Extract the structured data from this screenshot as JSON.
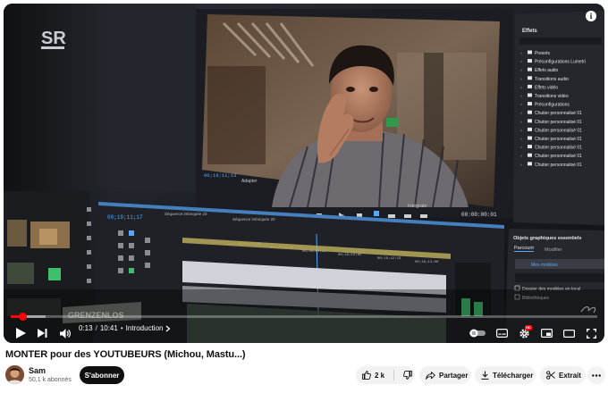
{
  "video": {
    "overlay": {
      "channel_logo": "SR",
      "watermark": "GRENZENLOS"
    },
    "effects_panel": {
      "title": "Effets",
      "items": [
        "Presets",
        "Préconfigurations Lumetri",
        "Effets audio",
        "Transitions audio",
        "Effets vidéo",
        "Transitions vidéo",
        "Préconfigurations",
        "Chutier personnalisé 01",
        "Chutier personnalisé 01",
        "Chutier personnalisé 01",
        "Chutier personnalisé 01",
        "Chutier personnalisé 01",
        "Chutier personnalisé 01",
        "Chutier personnalisé 01"
      ]
    },
    "graphics_panel": {
      "title": "Objets graphiques essentiels",
      "tab_browse": "Parcourir",
      "tab_edit": "Modifier",
      "my_templates": "Mes modèles",
      "local_folder": "Dossier des modèles en local",
      "libraries": "Bibliothèques"
    },
    "monitor": {
      "timecode_left": "00;19;11;13",
      "fit": "Adapter",
      "quality": "Intégrale",
      "timecode_right": "00:00:00:01"
    },
    "timeline": {
      "timecode": "00;19;11;17",
      "sequence_labels": [
        "Séquence imbriquée 23",
        "Séquence imbriquée 20"
      ],
      "ruler_marks": [
        "00;19;11;05",
        "00;19;11;09",
        "00;19;11;13",
        "00;19;12;05",
        "00;19;12;13",
        "00;19;13;00"
      ]
    }
  },
  "player": {
    "current_time": "0:13",
    "duration": "10:41",
    "chapter": "Introduction",
    "progress_fraction": 0.0203,
    "buffered_fraction": 0.06,
    "info_icon": "info-icon",
    "hd_badge": "HD"
  },
  "details": {
    "title": "MONTER pour des YOUTUBEURS (Michou, Mastu...)",
    "channel": "Sam",
    "subscribers": "50,1 k abonnés",
    "subscribe_label": "S'abonner",
    "likes": "2 k",
    "share_label": "Partager",
    "download_label": "Télécharger",
    "clip_label": "Extrait"
  },
  "colors": {
    "progress": "#ff0000",
    "subscribe_bg": "#0f0f0f",
    "pill_bg": "#f2f2f2"
  }
}
